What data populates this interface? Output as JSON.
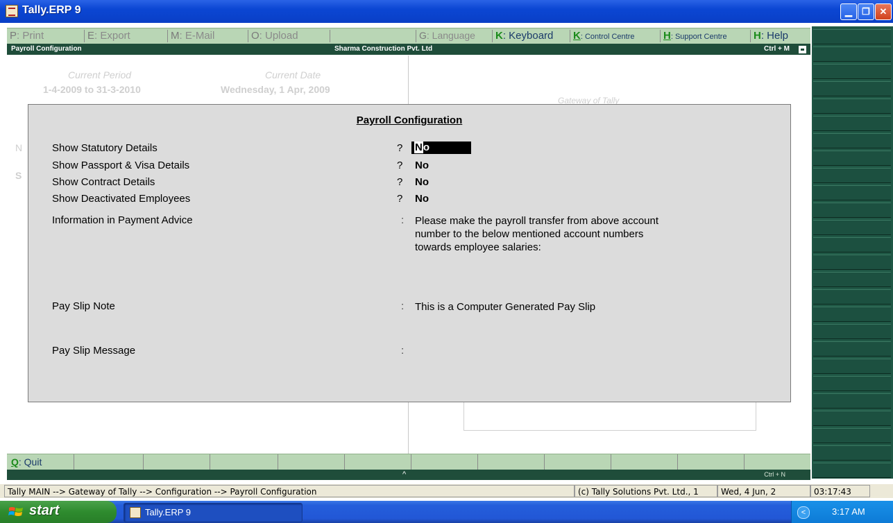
{
  "window": {
    "title": "Tally.ERP 9",
    "controls": [
      "minimize",
      "restore",
      "close"
    ]
  },
  "menu": {
    "items": [
      {
        "key": "P",
        "label": ": Print",
        "enabled": false
      },
      {
        "key": "E",
        "label": ": Export",
        "enabled": false
      },
      {
        "key": "M",
        "label": ": E-Mail",
        "enabled": false
      },
      {
        "key": "O",
        "label": ": Upload",
        "enabled": false
      },
      {
        "key": "G",
        "label": ": Language",
        "enabled": false
      },
      {
        "key": "K",
        "label": ": Keyboard",
        "enabled": true
      },
      {
        "key": "K",
        "label": ": Control Centre",
        "enabled": true
      },
      {
        "key": "H",
        "label": ": Support Centre",
        "enabled": true
      },
      {
        "key": "H",
        "label": ": Help",
        "enabled": true
      }
    ]
  },
  "header": {
    "screen": "Payroll Configuration",
    "company": "Sharma Construction Pvt. Ltd",
    "shortcut": "Ctrl + M"
  },
  "background": {
    "period_label": "Current Period",
    "period_value": "1-4-2009 to 31-3-2010",
    "date_label": "Current Date",
    "date_value": "Wednesday, 1 Apr, 2009",
    "gateway_label": "Gateway of Tally",
    "n_letter": "N",
    "s_letter": "S"
  },
  "dialog": {
    "title": "Payroll Configuration",
    "fields": {
      "statutory": {
        "label": "Show Statutory Details",
        "prompt": "?",
        "value": "No"
      },
      "passport": {
        "label": "Show Passport & Visa Details",
        "prompt": "?",
        "value": "No"
      },
      "contract": {
        "label": "Show Contract Details",
        "prompt": "?",
        "value": "No"
      },
      "deactivated": {
        "label": "Show Deactivated Employees",
        "prompt": "?",
        "value": "No"
      },
      "payment_advice": {
        "label": "Information in Payment Advice",
        "prompt": ":",
        "lines": [
          "Please make the payroll transfer from above account",
          "number to the below mentioned account numbers",
          "towards employee salaries:"
        ]
      },
      "slip_note": {
        "label": "Pay Slip Note",
        "prompt": ":",
        "value": "This is a Computer Generated Pay Slip"
      },
      "slip_message": {
        "label": "Pay Slip Message",
        "prompt": ":",
        "value": ""
      }
    }
  },
  "bottombar": {
    "quit_key": "Q",
    "quit_label": ": Quit",
    "arrow": "^",
    "shortcut": "Ctrl + N"
  },
  "status": {
    "breadcrumb": "Tally MAIN --> Gateway of Tally --> Configuration --> Payroll Configuration",
    "copyright": "(c) Tally Solutions Pvt. Ltd., 1",
    "date": "Wed, 4 Jun, 2",
    "time": "03:17:43"
  },
  "taskbar": {
    "start_label": "start",
    "task_label": "Tally.ERP 9",
    "clock": "3:17 AM",
    "tray_arrow": "<"
  },
  "colors": {
    "menu_bg": "#b9d6b5",
    "header_bg": "#1f4d3a",
    "side_panel": "#1f5745",
    "dialog_bg": "#dcdcdc"
  }
}
